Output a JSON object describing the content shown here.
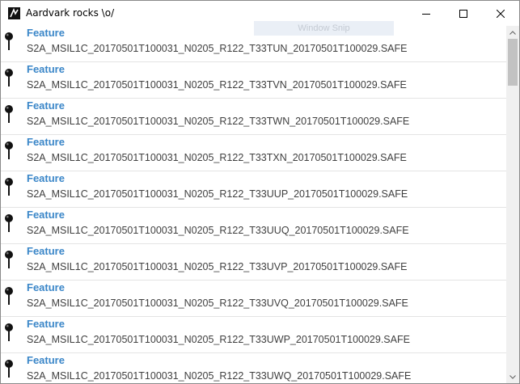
{
  "window": {
    "title": "Aardvark rocks \\o/",
    "overlay_text": "Window Snip",
    "controls": {
      "minimize_icon": "minimize-icon",
      "maximize_icon": "maximize-icon",
      "close_icon": "close-icon"
    }
  },
  "colors": {
    "accent": "#3a86c8",
    "text": "#404040",
    "divider": "#e4e4e4"
  },
  "list": {
    "item_icon": "map-pin-icon",
    "items": [
      {
        "title": "Feature",
        "name": "S2A_MSIL1C_20170501T100031_N0205_R122_T33TUN_20170501T100029.SAFE"
      },
      {
        "title": "Feature",
        "name": "S2A_MSIL1C_20170501T100031_N0205_R122_T33TVN_20170501T100029.SAFE"
      },
      {
        "title": "Feature",
        "name": "S2A_MSIL1C_20170501T100031_N0205_R122_T33TWN_20170501T100029.SAFE"
      },
      {
        "title": "Feature",
        "name": "S2A_MSIL1C_20170501T100031_N0205_R122_T33TXN_20170501T100029.SAFE"
      },
      {
        "title": "Feature",
        "name": "S2A_MSIL1C_20170501T100031_N0205_R122_T33UUP_20170501T100029.SAFE"
      },
      {
        "title": "Feature",
        "name": "S2A_MSIL1C_20170501T100031_N0205_R122_T33UUQ_20170501T100029.SAFE"
      },
      {
        "title": "Feature",
        "name": "S2A_MSIL1C_20170501T100031_N0205_R122_T33UVP_20170501T100029.SAFE"
      },
      {
        "title": "Feature",
        "name": "S2A_MSIL1C_20170501T100031_N0205_R122_T33UVQ_20170501T100029.SAFE"
      },
      {
        "title": "Feature",
        "name": "S2A_MSIL1C_20170501T100031_N0205_R122_T33UWP_20170501T100029.SAFE"
      },
      {
        "title": "Feature",
        "name": "S2A_MSIL1C_20170501T100031_N0205_R122_T33UWQ_20170501T100029.SAFE"
      }
    ]
  },
  "scrollbar": {
    "position": 0
  }
}
